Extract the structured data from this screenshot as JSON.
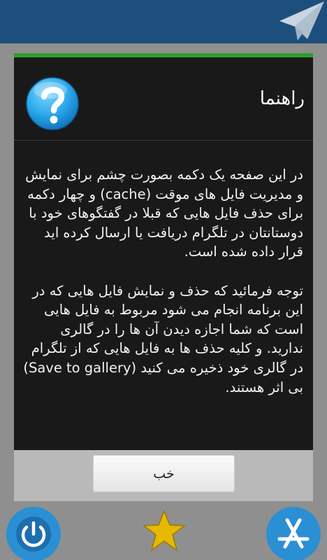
{
  "dialog": {
    "title": "راهنما",
    "paragraph1": "در این صفحه یک دکمه بصورت چشم برای نمایش و مدیریت فایل های موقت (cache) و چهار دکمه برای حذف فایل هایی که قبلا در گفتگوهای خود با دوستانتان در تلگرام دریافت یا ارسال کرده اید قرار داده شده است.",
    "paragraph2": "توجه فرمائید که حذف و نمایش فایل هایی که در این برنامه انجام می شود مربوط به فایل هایی است که شما اجازه دیدن آن ها را در گالری ندارید. و کلیه حذف ها به فایل هایی که از تلگرام در گالری خود ذخیره می کنید (Save to gallery) بی اثر هستند.",
    "ok_label": "خب",
    "help_icon": "question-mark-icon",
    "accent_color": "#2e9e2e"
  },
  "header": {
    "icon": "telegram-plane-icon",
    "color": "#1d4f7c"
  },
  "bottom_bar": {
    "icons": [
      "power-icon",
      "star-icon",
      "app-store-icon"
    ]
  }
}
